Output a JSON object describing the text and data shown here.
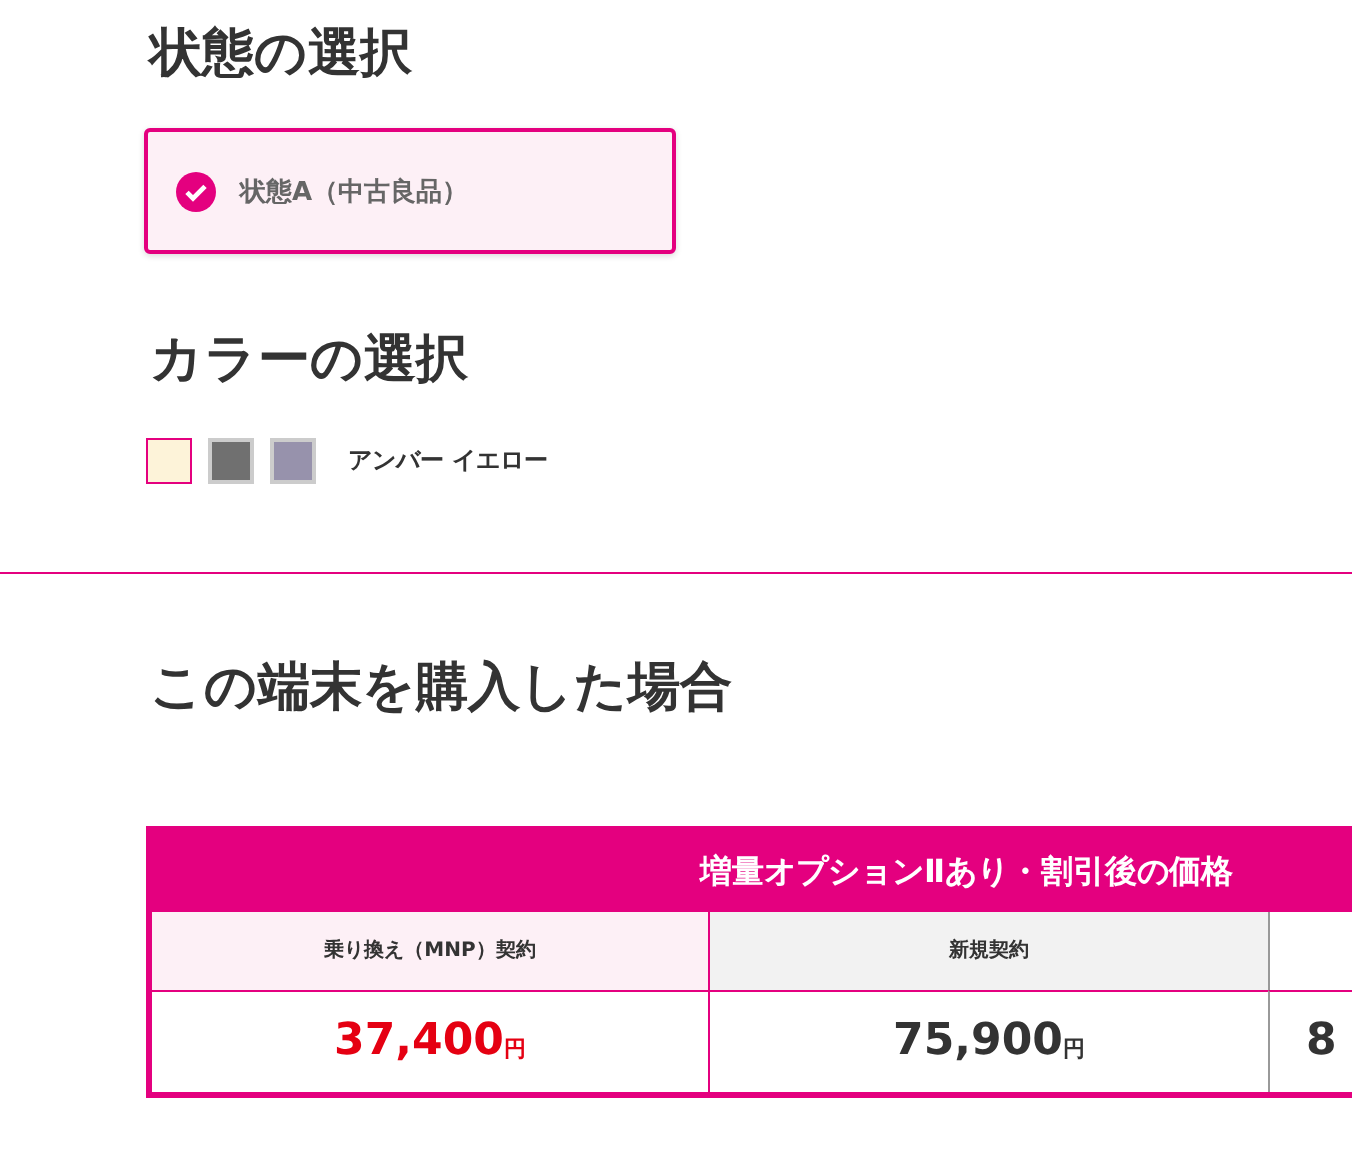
{
  "condition": {
    "title": "状態の選択",
    "options": [
      {
        "label": "状態A（中古良品）",
        "selected": true
      }
    ]
  },
  "color": {
    "title": "カラーの選択",
    "swatches": [
      {
        "color": "#fdf3d9",
        "selected": true
      },
      {
        "color": "#707070",
        "selected": false
      },
      {
        "color": "#9792ac",
        "selected": false
      }
    ],
    "selected_name": "アンバー イエロー"
  },
  "purchase": {
    "title": "この端末を購入した場合",
    "table_title": "増量オプションⅡあり・割引後の価格",
    "columns": [
      {
        "kind": "mnp",
        "header": "乗り換え（MNP）契約",
        "price": "37,400",
        "unit": "円"
      },
      {
        "kind": "new",
        "header": "新規契約",
        "price": "75,900",
        "unit": "円"
      },
      {
        "kind": "cut",
        "price": "8"
      }
    ]
  }
}
